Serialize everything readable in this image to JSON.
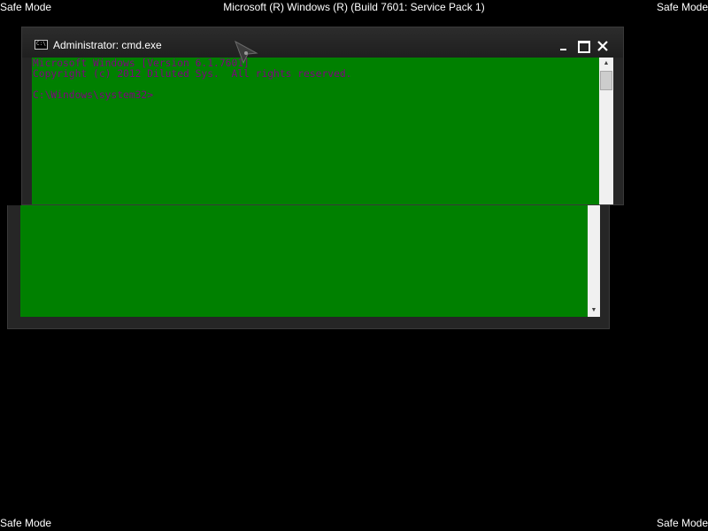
{
  "screen": {
    "safe_mode_label": "Safe Mode",
    "build_banner": "Microsoft (R) Windows (R) (Build 7601: Service Pack 1)"
  },
  "window": {
    "title": "Administrator: cmd.exe",
    "icon": "cmd-icon",
    "buttons": [
      "minimize-icon",
      "maximize-icon",
      "close-icon"
    ]
  },
  "console": {
    "lines": [
      "Microsoft Windows [Version 6.1.7601]",
      "Copyright (c) 2012 Diluted Sys.  All rights reserved.",
      "",
      "C:\\Windows\\system32>"
    ],
    "background_color": "#008000",
    "text_color": "#800080"
  },
  "colors": {
    "desktop": "#000000",
    "window_frame": "#262626"
  }
}
